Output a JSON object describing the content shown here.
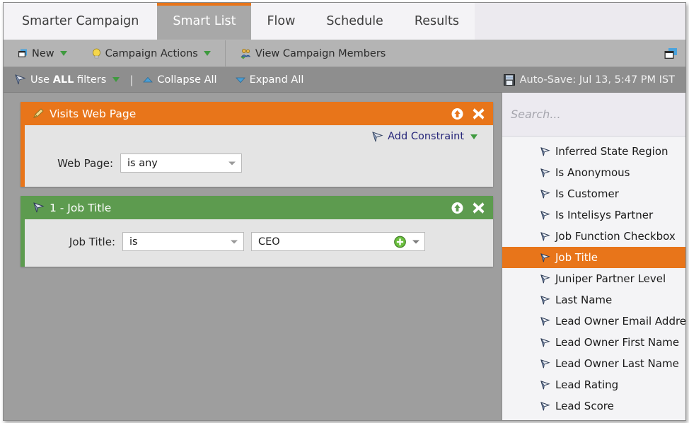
{
  "tabs": [
    {
      "label": "Smarter Campaign",
      "active": false
    },
    {
      "label": "Smart List",
      "active": true
    },
    {
      "label": "Flow",
      "active": false
    },
    {
      "label": "Schedule",
      "active": false
    },
    {
      "label": "Results",
      "active": false
    }
  ],
  "toolbar": {
    "new_label": "New",
    "campaign_actions_label": "Campaign Actions",
    "view_members_label": "View Campaign Members",
    "panel_toggle_icon": "window-icon"
  },
  "filterbar": {
    "use_filters_prefix": "Use ",
    "use_filters_bold": "ALL",
    "use_filters_suffix": " filters",
    "divider": "|",
    "collapse_all": "Collapse All",
    "expand_all": "Expand All",
    "autosave": "Auto-Save: Jul 13, 5:47 PM IST"
  },
  "panels": [
    {
      "id": "visits-web-page",
      "title": "Visits Web Page",
      "color": "#e8751a",
      "icon": "pencil-filter-icon",
      "add_constraint_label": "Add Constraint",
      "rows": [
        {
          "label": "Web Page:",
          "operator": "is any"
        }
      ]
    },
    {
      "id": "job-title",
      "title": "1 - Job Title",
      "color": "#5d9b4f",
      "icon": "funnel-icon",
      "rows": [
        {
          "label": "Job Title:",
          "operator": "is",
          "value": "CEO"
        }
      ]
    }
  ],
  "sidebar": {
    "search_placeholder": "Search...",
    "search_value": "",
    "items": [
      {
        "label": "Inferred State Region",
        "selected": false
      },
      {
        "label": "Is Anonymous",
        "selected": false
      },
      {
        "label": "Is Customer",
        "selected": false
      },
      {
        "label": "Is Intelisys Partner",
        "selected": false
      },
      {
        "label": "Job Function Checkbox",
        "selected": false
      },
      {
        "label": "Job Title",
        "selected": true
      },
      {
        "label": "Juniper Partner Level",
        "selected": false
      },
      {
        "label": "Last Name",
        "selected": false
      },
      {
        "label": "Lead Owner Email Address",
        "selected": false
      },
      {
        "label": "Lead Owner First Name",
        "selected": false
      },
      {
        "label": "Lead Owner Last Name",
        "selected": false
      },
      {
        "label": "Lead Rating",
        "selected": false
      },
      {
        "label": "Lead Score",
        "selected": false
      }
    ]
  },
  "colors": {
    "accent_orange": "#e8751a",
    "accent_green": "#5d9b4f",
    "toolbar_gray": "#b4b4b4",
    "filterbar_gray": "#8e8e8e",
    "canvas_gray": "#9e9e9e"
  }
}
